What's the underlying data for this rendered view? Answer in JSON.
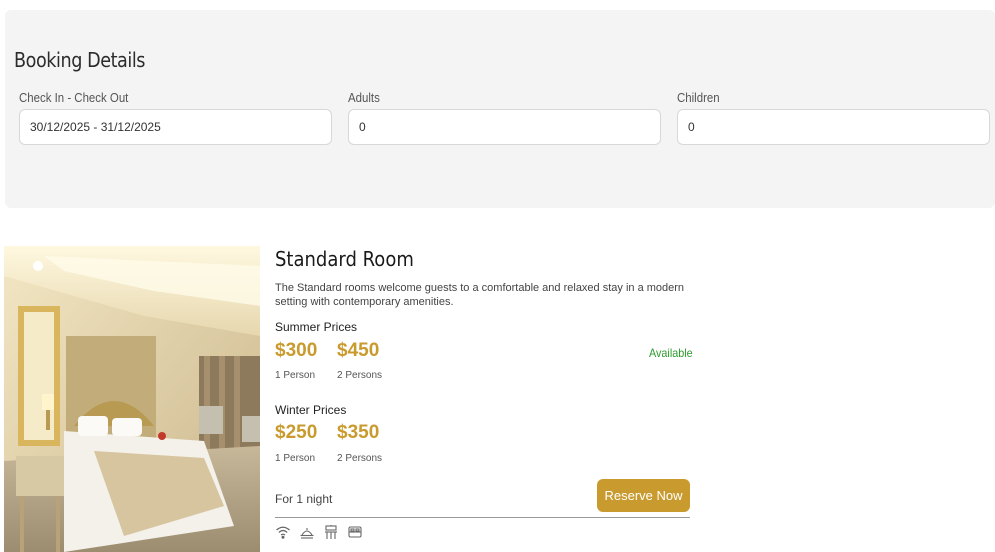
{
  "booking": {
    "title": "Booking Details",
    "checkin_label": "Check In - Check Out",
    "checkin_value": "30/12/2025 - 31/12/2025",
    "adults_label": "Adults",
    "adults_value": "0",
    "children_label": "Children",
    "children_value": "0"
  },
  "room": {
    "title": "Standard Room",
    "description": "The Standard rooms welcome guests to a comfortable and relaxed stay in a modern setting with contemporary amenities.",
    "availability": "Available",
    "summer": {
      "label": "Summer Prices",
      "price_1": "$300",
      "price_2": "$450",
      "persons_1": "1 Person",
      "persons_2": "2 Persons"
    },
    "winter": {
      "label": "Winter Prices",
      "price_1": "$250",
      "price_2": "$350",
      "persons_1": "1 Person",
      "persons_2": "2 Persons"
    },
    "nights": "For 1 night",
    "reserve_label": "Reserve Now",
    "amenity_icons": [
      "wifi-icon",
      "room-service-icon",
      "furniture-icon",
      "bed-icon"
    ]
  },
  "colors": {
    "accent": "#c99b2e",
    "available": "#2e9b2e",
    "panel_bg": "#f4f4f4"
  }
}
